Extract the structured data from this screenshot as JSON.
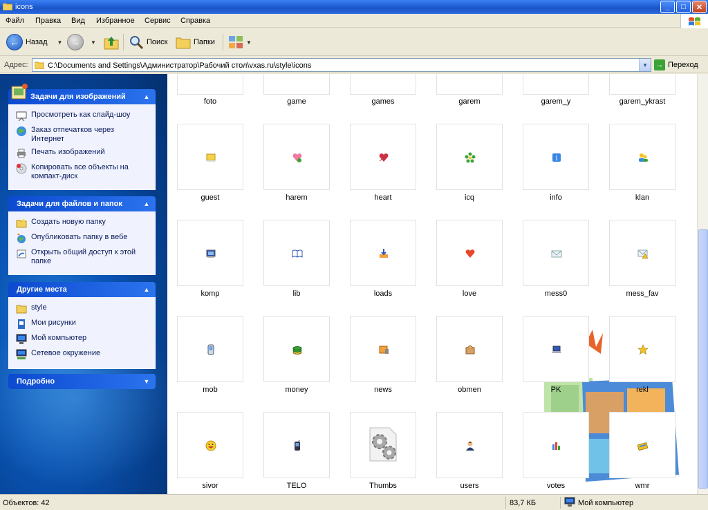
{
  "window": {
    "title": "icons"
  },
  "menu": [
    "Файл",
    "Правка",
    "Вид",
    "Избранное",
    "Сервис",
    "Справка"
  ],
  "toolbar": {
    "back": "Назад",
    "search": "Поиск",
    "folders": "Папки"
  },
  "address": {
    "label": "Адрес:",
    "path": "C:\\Documents and Settings\\Администратор\\Рабочий стол\\vxas.ru\\style\\icons",
    "go": "Переход"
  },
  "panels": {
    "image_tasks": {
      "title": "Задачи для изображений",
      "items": [
        "Просмотреть как слайд-шоу",
        "Заказ отпечатков через Интернет",
        "Печать изображений",
        "Копировать все объекты на компакт-диск"
      ]
    },
    "file_tasks": {
      "title": "Задачи для файлов и папок",
      "items": [
        "Создать новую папку",
        "Опубликовать папку в вебе",
        "Открыть общий доступ к этой папке"
      ]
    },
    "other_places": {
      "title": "Другие места",
      "items": [
        "style",
        "Мои рисунки",
        "Мой компьютер",
        "Сетевое окружение"
      ]
    },
    "details": {
      "title": "Подробно"
    }
  },
  "files": {
    "row0": [
      "foto",
      "game",
      "games",
      "garem",
      "garem_y",
      "garem_ykrast"
    ],
    "row1": [
      "guest",
      "harem",
      "heart",
      "icq",
      "info",
      "klan"
    ],
    "row2": [
      "komp",
      "lib",
      "loads",
      "love",
      "mess0",
      "mess_fav"
    ],
    "row3": [
      "mob",
      "money",
      "news",
      "obmen",
      "PK",
      "rekl"
    ],
    "row4": [
      "sivor",
      "TELO",
      "Thumbs",
      "users",
      "votes",
      "wmr"
    ]
  },
  "status": {
    "objects": "Объектов: 42",
    "size": "83,7 КБ",
    "location": "Мой компьютер"
  }
}
